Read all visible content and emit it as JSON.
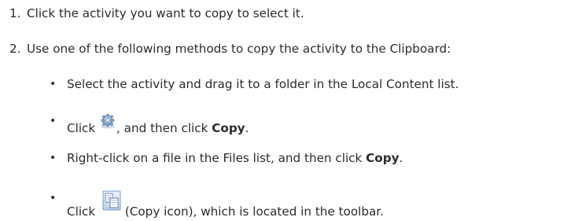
{
  "steps": [
    {
      "number": "1.",
      "text": "Click the activity you want to copy to select it."
    },
    {
      "number": "2.",
      "text": "Use one of the following methods to copy the activity to the Clipboard:"
    }
  ],
  "methods": [
    {
      "bullet": "•",
      "text": "Select the activity and drag it to a folder in the Local Content list."
    },
    {
      "bullet": "•",
      "pre": "Click",
      "icon": "gear-icon",
      "mid": ", and then click",
      "bold": "Copy",
      "post": "."
    },
    {
      "bullet": "•",
      "pre": "Right-click on a file in the Files list, and then click",
      "bold": "Copy",
      "post": "."
    },
    {
      "bullet": "•",
      "pre": "Click",
      "icon": "copy-icon",
      "post": "(Copy icon), which is located in the toolbar."
    }
  ]
}
